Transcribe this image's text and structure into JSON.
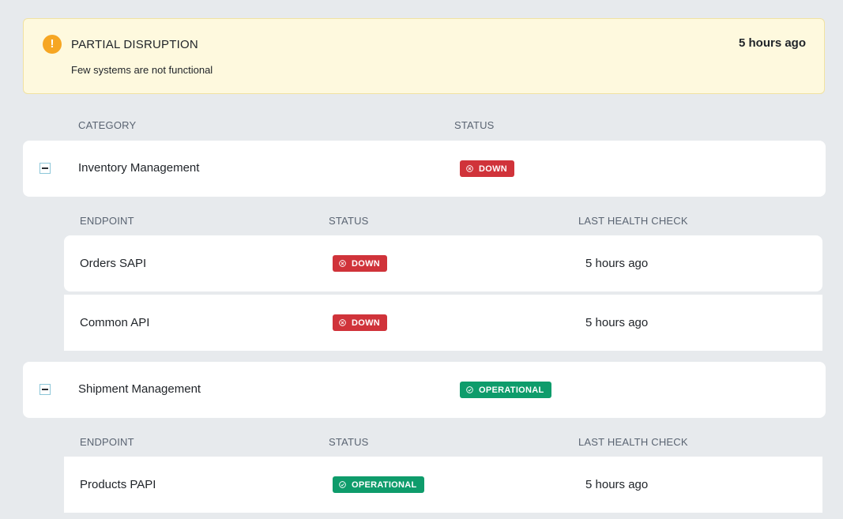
{
  "alert": {
    "icon": "exclamation-circle-icon",
    "title": "PARTIAL DISRUPTION",
    "description": "Few systems are not functional",
    "time": "5 hours ago",
    "color": "#f6a623"
  },
  "headers": {
    "category": "CATEGORY",
    "status": "STATUS",
    "endpoint": "ENDPOINT",
    "last_health_check": "LAST HEALTH CHECK"
  },
  "colors": {
    "down": "#d0333a",
    "operational": "#0e9c6b"
  },
  "categories": [
    {
      "name": "Inventory Management",
      "status": "DOWN",
      "endpoints": [
        {
          "name": "Orders SAPI",
          "status": "DOWN",
          "last_check": "5 hours ago"
        },
        {
          "name": "Common API",
          "status": "DOWN",
          "last_check": "5 hours ago"
        }
      ]
    },
    {
      "name": "Shipment Management",
      "status": "OPERATIONAL",
      "endpoints": [
        {
          "name": "Products PAPI",
          "status": "OPERATIONAL",
          "last_check": "5 hours ago"
        }
      ]
    }
  ]
}
